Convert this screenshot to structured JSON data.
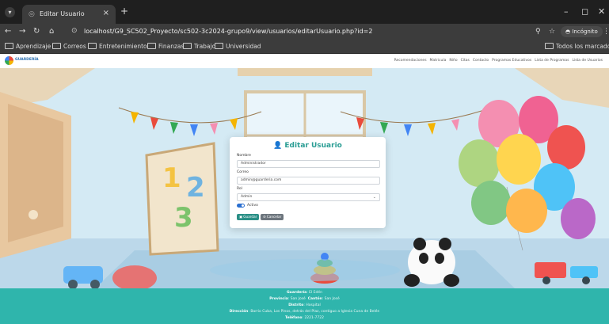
{
  "browser": {
    "tab_title": "Editar Usuario",
    "tab_close": "×",
    "new_tab": "+",
    "url": "localhost/G9_SC502_Proyecto/sc502-3c2024-grupo9/view/usuarios/editarUsuario.php?id=2",
    "incognito_label": "Incógnito",
    "icons": [
      "back-icon",
      "forward-icon",
      "reload-icon",
      "home-icon",
      "site-info-icon",
      "zoom-icon",
      "star-icon",
      "incognito-icon",
      "menu-icon"
    ]
  },
  "bookmarks": {
    "items": [
      "Aprendizaje",
      "Correos",
      "Entretenimiento",
      "Finanzas",
      "Trabajo",
      "Universidad"
    ],
    "all_bookmarks": "Todos los marcadores"
  },
  "site": {
    "nav_links": [
      "Recomendaciones",
      "Matricula",
      "Niño",
      "Citas",
      "Contacto",
      "Programas Educativos",
      "Lista de Programas",
      "Lista de Usuarios"
    ]
  },
  "form": {
    "title": "Editar Usuario",
    "nombre_label": "Nombre",
    "nombre_value": "Administrador",
    "correo_label": "Correo",
    "correo_value": "admin@guarderia.com",
    "rol_label": "Rol",
    "rol_value": "Admin",
    "activo_label": "Activo",
    "activo_checked": true,
    "save_label": "Guardar",
    "cancel_label": "Cancelar"
  },
  "footer": {
    "line1_label": "Guardería",
    "line1_value": "El Edén",
    "line2a_label": "Provincia",
    "line2a_value": "San José",
    "line2b_label": "Cantón",
    "line2b_value": "San José",
    "line3_label": "Distrito",
    "line3_value": "Hospital",
    "line4_label": "Dirección",
    "line4_value": "Barrio Cuba, Los Pinos, detrás del Plaz, contiguo a Iglesia Cuna de Belén",
    "line5_label": "Teléfono",
    "line5_value": "2221-7722"
  },
  "colors": {
    "accent": "#2a9d94",
    "footer": "#2fb5ac",
    "chrome_dark": "#1f1f1f"
  }
}
